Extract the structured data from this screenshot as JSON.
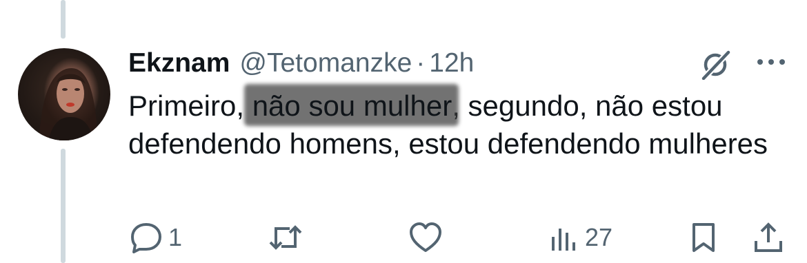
{
  "tweet": {
    "author_name": "Ekznam",
    "author_handle": "@Tetomanzke",
    "separator": "·",
    "time": "12h",
    "text_before": "Primeiro, ",
    "text_redacted": "não sou mulher",
    "text_after": ", segundo, não estou defendendo homens, estou defendendo mulheres"
  },
  "actions": {
    "reply_count": "1",
    "views_count": "27"
  },
  "icons": {
    "avatar": "avatar",
    "grok": "grok-icon",
    "more": "more-icon",
    "reply": "reply-icon",
    "retweet": "retweet-icon",
    "like": "like-icon",
    "views": "views-icon",
    "bookmark": "bookmark-icon",
    "share": "share-icon"
  },
  "colors": {
    "text": "#0f1419",
    "secondary": "#536471",
    "thread_line": "#cfd9de"
  }
}
